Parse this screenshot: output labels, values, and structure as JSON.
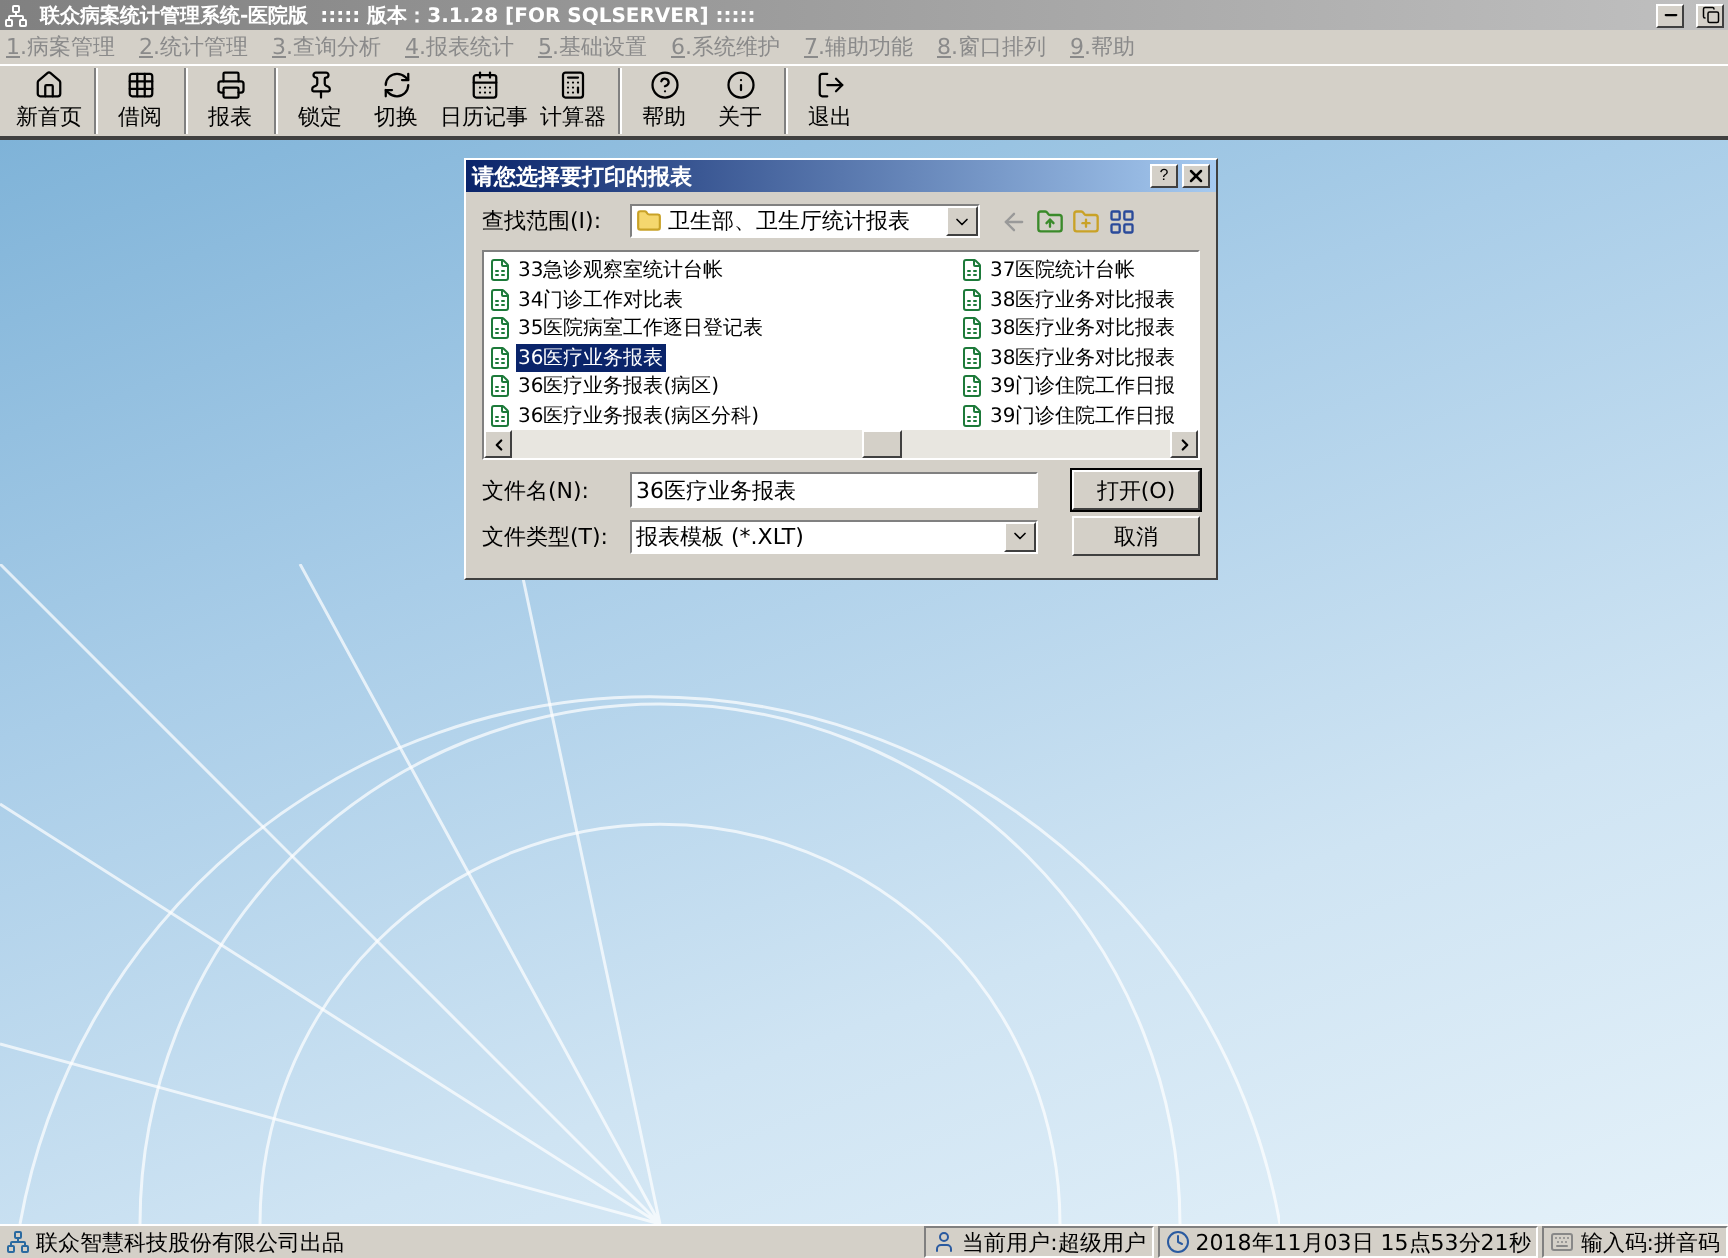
{
  "window": {
    "title": "联众病案统计管理系统-医院版",
    "version": ":::::  版本：3.1.28 [FOR SQLSERVER]  :::::"
  },
  "menu": [
    {
      "key": "1",
      "label": ".病案管理",
      "disabled": true
    },
    {
      "key": "2",
      "label": ".统计管理",
      "disabled": true
    },
    {
      "key": "3",
      "label": ".查询分析",
      "disabled": true
    },
    {
      "key": "4",
      "label": ".报表统计",
      "disabled": true
    },
    {
      "key": "5",
      "label": ".基础设置",
      "disabled": true
    },
    {
      "key": "6",
      "label": ".系统维护",
      "disabled": true
    },
    {
      "key": "7",
      "label": ".辅助功能",
      "disabled": true
    },
    {
      "key": "8",
      "label": ".窗口排列",
      "disabled": true
    },
    {
      "key": "9",
      "label": ".帮助",
      "disabled": true
    }
  ],
  "toolbar": [
    [
      {
        "kind": "home",
        "label": "新首页"
      }
    ],
    [
      {
        "kind": "grid",
        "label": "借阅"
      }
    ],
    [
      {
        "kind": "printer",
        "label": "报表"
      }
    ],
    [
      {
        "kind": "pin",
        "label": "锁定"
      },
      {
        "kind": "swap",
        "label": "切换"
      },
      {
        "kind": "calendar",
        "label": "日历记事"
      },
      {
        "kind": "calculator",
        "label": "计算器"
      }
    ],
    [
      {
        "kind": "help",
        "label": "帮助"
      },
      {
        "kind": "about",
        "label": "关于"
      }
    ],
    [
      {
        "kind": "exit",
        "label": "退出"
      }
    ]
  ],
  "dialog": {
    "title": "请您选择要打印的报表",
    "look_in_label": "查找范围(I):",
    "look_in_value": "卫生部、卫生厅统计报表",
    "files": [
      [
        {
          "name": "33急诊观察室统计台帐",
          "selected": false
        },
        {
          "name": "34门诊工作对比表",
          "selected": false
        },
        {
          "name": "35医院病室工作逐日登记表",
          "selected": false
        },
        {
          "name": "36医疗业务报表",
          "selected": true
        },
        {
          "name": "36医疗业务报表(病区)",
          "selected": false
        },
        {
          "name": "36医疗业务报表(病区分科)",
          "selected": false
        }
      ],
      [
        {
          "name": "37医院统计台帐",
          "selected": false
        },
        {
          "name": "38医疗业务对比报表",
          "selected": false
        },
        {
          "name": "38医疗业务对比报表",
          "selected": false
        },
        {
          "name": "38医疗业务对比报表",
          "selected": false
        },
        {
          "name": "39门诊住院工作日报",
          "selected": false
        },
        {
          "name": "39门诊住院工作日报",
          "selected": false
        }
      ]
    ],
    "help_button": "?",
    "filename_label": "文件名(N):",
    "filename_value": "36医疗业务报表",
    "filetype_label": "文件类型(T):",
    "filetype_value": "报表模板 (*.XLT)",
    "open_button": "打开(O)",
    "cancel_button": "取消"
  },
  "status_bar": {
    "vendor": "联众智慧科技股份有限公司出品",
    "user": "当前用户:超级用户",
    "datetime": "2018年11月03日 15点53分21秒",
    "input": "输入码:拼音码"
  }
}
